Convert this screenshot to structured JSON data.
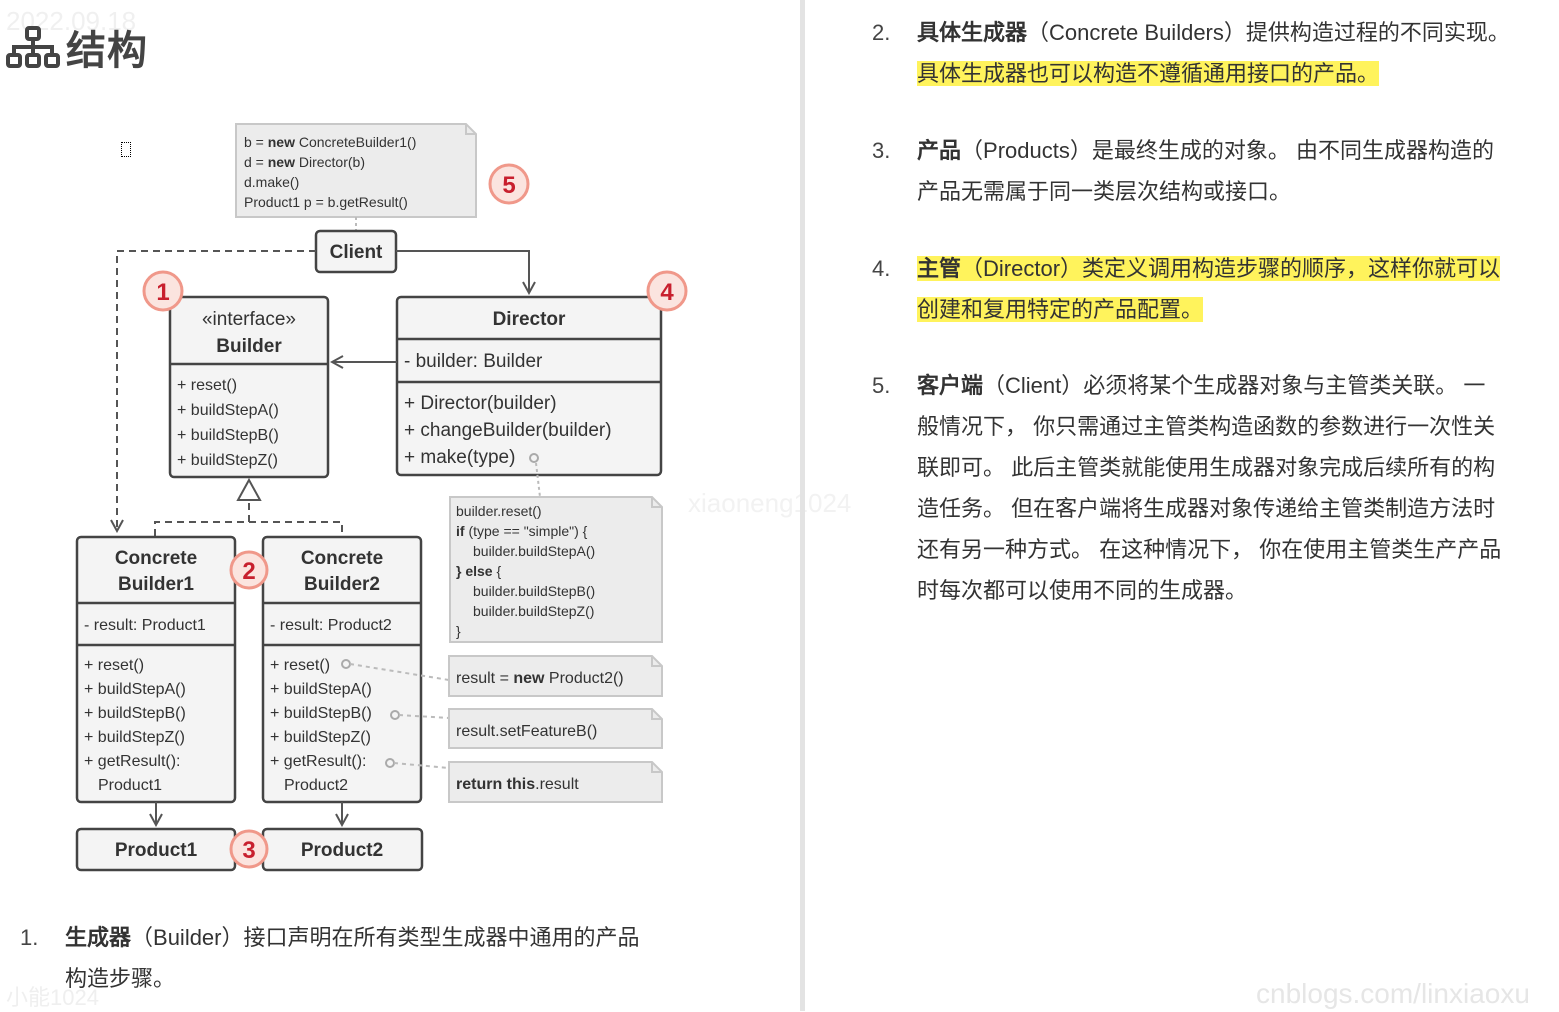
{
  "page": {
    "section_title": "结构",
    "section_icon": "sitemap-icon",
    "watermarks": {
      "date": "2022.09.18",
      "bottom_left": "小能1024",
      "middle": "xiaoneng1024",
      "site": "cnblogs.com/linxiaoxu"
    }
  },
  "diagram": {
    "client_note": {
      "lines": [
        {
          "pre": "b = ",
          "kw": "new",
          "post": " ConcreteBuilder1()"
        },
        {
          "pre": "d = ",
          "kw": "new",
          "post": " Director(b)"
        },
        {
          "pre": "d.make()",
          "kw": "",
          "post": ""
        },
        {
          "pre": "Product1 p = b.getResult()",
          "kw": "",
          "post": ""
        }
      ]
    },
    "client": {
      "label": "Client"
    },
    "builder": {
      "stereotype": "«interface»",
      "name": "Builder",
      "methods": [
        "+ reset()",
        "+ buildStepA()",
        "+ buildStepB()",
        "+ buildStepZ()"
      ]
    },
    "director": {
      "name": "Director",
      "fields": [
        "- builder: Builder"
      ],
      "methods": [
        "+ Director(builder)",
        "+ changeBuilder(builder)",
        "+ make(type)"
      ]
    },
    "make_note": {
      "lines": [
        {
          "indent": 0,
          "kw": "",
          "text": "builder.reset()"
        },
        {
          "indent": 0,
          "kw": "if",
          "text": " (type == \"simple\") {"
        },
        {
          "indent": 1,
          "kw": "",
          "text": "builder.buildStepA()"
        },
        {
          "indent": 0,
          "kw": "} else",
          "text": " {"
        },
        {
          "indent": 1,
          "kw": "",
          "text": "builder.buildStepB()"
        },
        {
          "indent": 1,
          "kw": "",
          "text": "builder.buildStepZ()"
        },
        {
          "indent": 0,
          "kw": "",
          "text": "}"
        }
      ]
    },
    "concrete_builder1": {
      "name_line1": "Concrete",
      "name_line2": "Builder1",
      "fields": [
        "- result: Product1"
      ],
      "methods": [
        "+ reset()",
        "+ buildStepA()",
        "+ buildStepB()",
        "+ buildStepZ()",
        "+ getResult():",
        "  Product1"
      ]
    },
    "concrete_builder2": {
      "name_line1": "Concrete",
      "name_line2": "Builder2",
      "fields": [
        "- result: Product2"
      ],
      "methods": [
        "+ reset()",
        "+ buildStepA()",
        "+ buildStepB()",
        "+ buildStepZ()",
        "+ getResult():",
        "  Product2"
      ]
    },
    "notes": {
      "reset": {
        "pre": "result = ",
        "kw": "new",
        "post": " Product2()"
      },
      "stepB": {
        "pre": "result.setFeatureB()",
        "kw": "",
        "post": ""
      },
      "getResult": {
        "pre": "",
        "kw": "return this",
        "post": ".result"
      }
    },
    "product1": {
      "label": "Product1"
    },
    "product2": {
      "label": "Product2"
    },
    "badges": [
      "1",
      "2",
      "3",
      "4",
      "5"
    ],
    "colors": {
      "box_fill": "#f4f4f4",
      "box_stroke": "#444444",
      "note_fill": "#ececec",
      "note_stroke": "#c8c8c8",
      "badge_fill": "#fbe4df",
      "badge_stroke": "#f0988a",
      "badge_text": "#c8202e",
      "highlight": "#fff35c"
    }
  },
  "list": [
    {
      "num": "1.",
      "term": "生成器",
      "paren": "（Builder）",
      "text": "接口声明在所有类型生成器中通用的产品",
      "text2": "构造步骤。"
    },
    {
      "num": "2.",
      "term": "具体生成器",
      "paren": "（Concrete Builders）",
      "text": "提供构造过程的不同实现。",
      "text2_hl": "具体生成器也可以构造不遵循通用接口的产品。"
    },
    {
      "num": "3.",
      "term": "产品",
      "paren": "（Products）",
      "text": "是最终生成的对象。 由不同生成器构造的",
      "text2": "产品无需属于同一类层次结构或接口。"
    },
    {
      "num": "4.",
      "term": "主管",
      "paren": "（Director）",
      "text": "类定义调用构造步骤的顺序，这样你就可以",
      "text2_hl": "创建和复用特定的产品配置。"
    },
    {
      "num": "5.",
      "term": "客户端",
      "paren": "（Client）",
      "text": "必须将某个生成器对象与主管类关联。 一",
      "more": [
        "般情况下， 你只需通过主管类构造函数的参数进行一次性关",
        "联即可。 此后主管类就能使用生成器对象完成后续所有的构",
        "造任务。 但在客户端将生成器对象传递给主管类制造方法时",
        "还有另一种方式。 在这种情况下， 你在使用主管类生产产品",
        "时每次都可以使用不同的生成器。"
      ]
    }
  ]
}
